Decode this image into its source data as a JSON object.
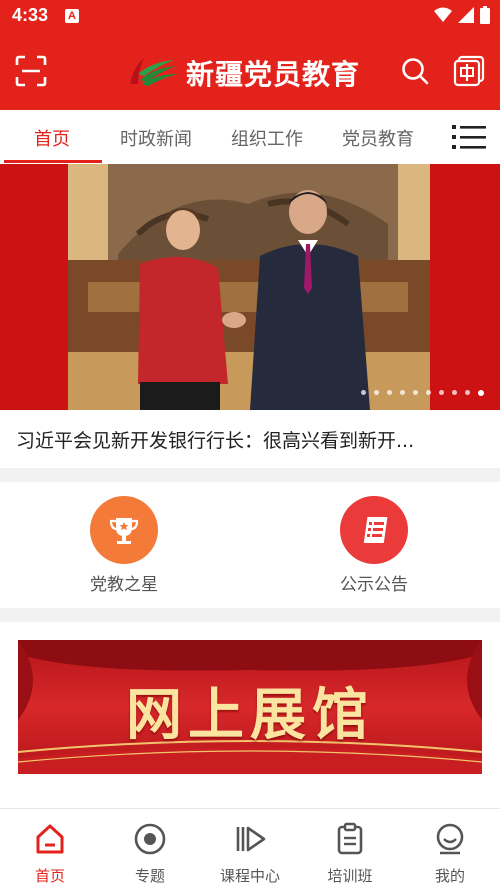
{
  "status_bar": {
    "time": "4:33",
    "notification_badge": "A"
  },
  "header": {
    "title": "新疆党员教育",
    "brand_color": "#e3231b"
  },
  "tabs": [
    {
      "label": "首页",
      "active": true
    },
    {
      "label": "时政新闻",
      "active": false
    },
    {
      "label": "组织工作",
      "active": false
    },
    {
      "label": "党员教育",
      "active": false
    }
  ],
  "carousel": {
    "headline": "习近平会见新开发银行行长：很高兴看到新开...",
    "slide_count": 10,
    "active_slide": 10
  },
  "quick_entries": [
    {
      "label": "党教之星",
      "icon": "trophy-icon",
      "color": "#f47a3a"
    },
    {
      "label": "公示公告",
      "icon": "document-list-icon",
      "color": "#ea3a3a"
    }
  ],
  "exhibition": {
    "title": "网上展馆"
  },
  "bottom_nav": [
    {
      "label": "首页",
      "icon": "home-icon",
      "active": true
    },
    {
      "label": "专题",
      "icon": "topic-icon",
      "active": false
    },
    {
      "label": "课程中心",
      "icon": "play-course-icon",
      "active": false
    },
    {
      "label": "培训班",
      "icon": "clipboard-icon",
      "active": false
    },
    {
      "label": "我的",
      "icon": "profile-icon",
      "active": false
    }
  ]
}
